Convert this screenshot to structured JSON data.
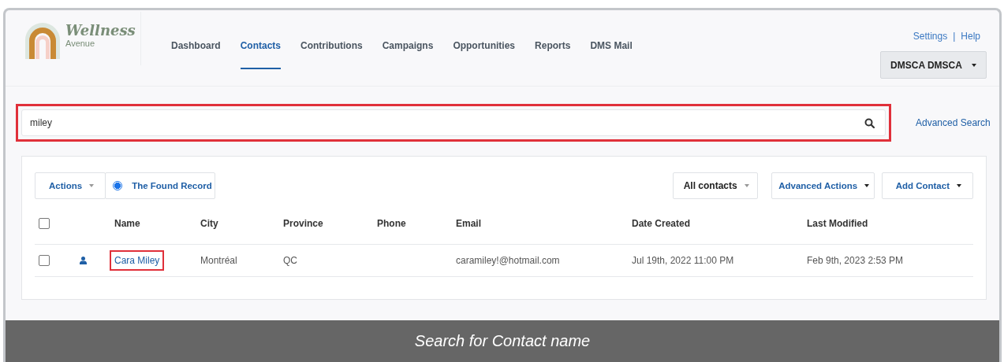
{
  "logo": {
    "title": "Wellness",
    "subtitle": "Avenue"
  },
  "nav": [
    {
      "label": "Dashboard",
      "selected": false
    },
    {
      "label": "Contacts",
      "selected": true
    },
    {
      "label": "Contributions",
      "selected": false
    },
    {
      "label": "Campaigns",
      "selected": false
    },
    {
      "label": "Opportunities",
      "selected": false
    },
    {
      "label": "Reports",
      "selected": false
    },
    {
      "label": "DMS Mail",
      "selected": false
    }
  ],
  "top_links": {
    "items": [
      "Settings",
      "Help"
    ],
    "separator": "|"
  },
  "user_menu": {
    "label": "DMSCA DMSCA"
  },
  "search": {
    "value": "miley",
    "highlighted": true
  },
  "advanced_search": "Advanced Search",
  "toolbar": {
    "actions": "Actions",
    "found_record": {
      "label": "The Found Record",
      "selected": true
    },
    "filter": "All contacts",
    "advanced_actions": "Advanced Actions",
    "add_contact": "Add Contact"
  },
  "table": {
    "select_all": {
      "checked": false
    },
    "columns": [
      "Name",
      "City",
      "Province",
      "Phone",
      "Email",
      "Date Created",
      "Last Modified"
    ],
    "rows": [
      {
        "checked": false,
        "name": "Cara Miley",
        "highlighted": true,
        "city": "Montréal",
        "province": "QC",
        "email": "caramiley!@hotmail.com",
        "date_created": "Jul 19th, 2022 11:00 PM",
        "last_modified": "Feb 9th, 2023 2:53 PM"
      }
    ]
  },
  "caption": "Search for Contact name"
}
